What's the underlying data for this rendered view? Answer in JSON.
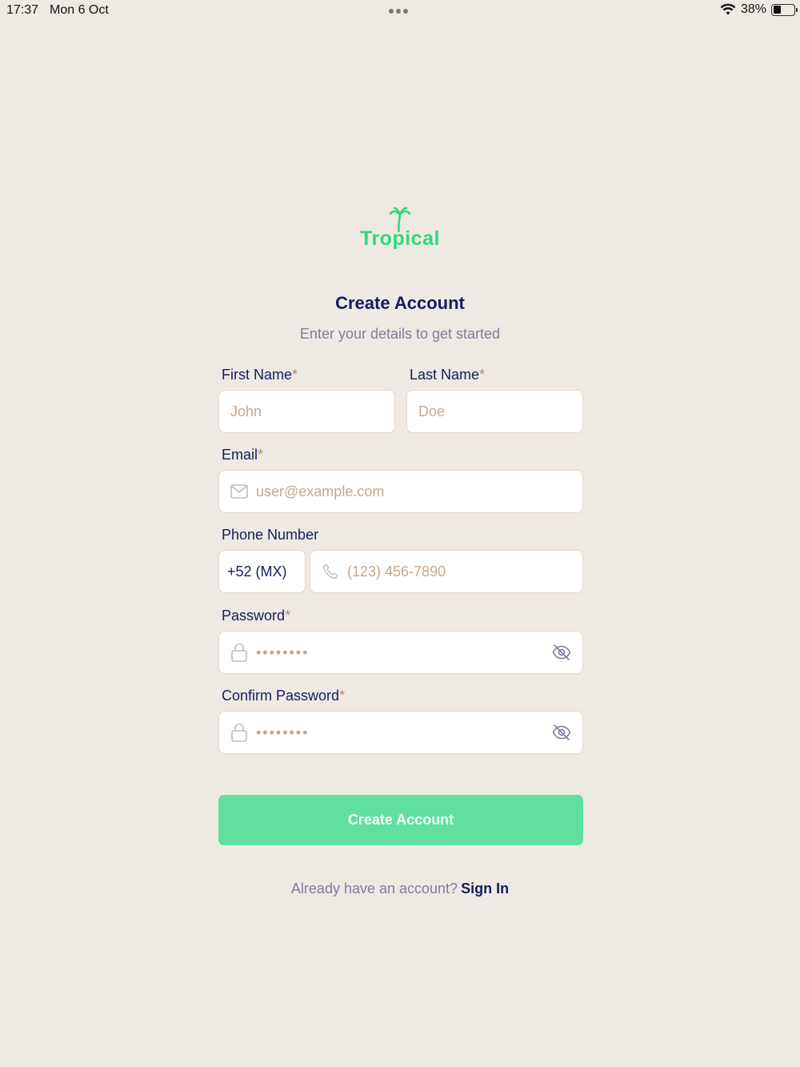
{
  "status_bar": {
    "time": "17:37",
    "date": "Mon 6 Oct",
    "battery": "38%",
    "battery_level": 0.38
  },
  "brand": {
    "name": "Tropical",
    "color": "#2fd97a"
  },
  "header": {
    "title": "Create Account",
    "subtitle": "Enter your details to get started"
  },
  "form": {
    "required_mark": "*",
    "first_name": {
      "label": "First Name",
      "placeholder": "John"
    },
    "last_name": {
      "label": "Last Name",
      "placeholder": "Doe"
    },
    "email": {
      "label": "Email",
      "placeholder": "user@example.com"
    },
    "phone": {
      "label": "Phone Number",
      "country_code": "+52 (MX)",
      "placeholder": "(123) 456-7890"
    },
    "password": {
      "label": "Password",
      "value": "••••••••"
    },
    "confirm_password": {
      "label": "Confirm Password",
      "value": "••••••••"
    },
    "submit_label": "Create Account"
  },
  "footer": {
    "question": "Already have an account?",
    "link": "Sign In"
  },
  "colors": {
    "background": "#eee9e3",
    "primary_button": "#61df9f",
    "heading": "#141c5e",
    "required": "#b9876a"
  }
}
